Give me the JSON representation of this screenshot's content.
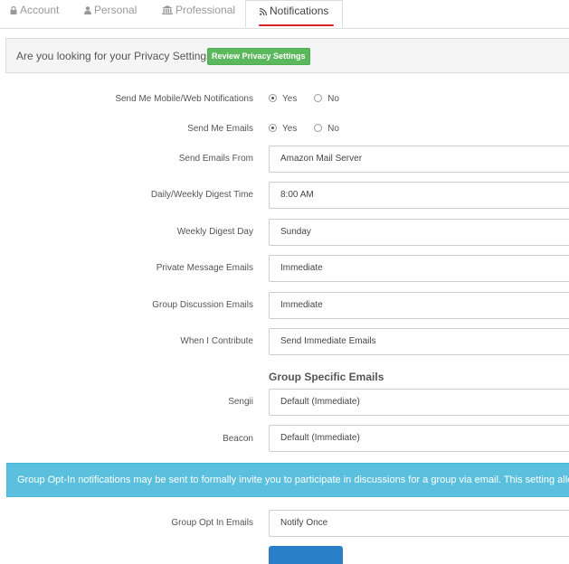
{
  "tabs": [
    {
      "label": "Account",
      "icon": "lock-icon"
    },
    {
      "label": "Personal",
      "icon": "user-icon"
    },
    {
      "label": "Professional",
      "icon": "institution-icon"
    },
    {
      "label": "Notifications",
      "icon": "rss-icon",
      "active": true
    }
  ],
  "privacy": {
    "text": "Are you looking for your Privacy Settings?",
    "button": "Review Privacy Settings"
  },
  "form": {
    "mobile_web": {
      "label": "Send Me Mobile/Web Notifications",
      "yes": "Yes",
      "no": "No",
      "selected": "Yes"
    },
    "emails": {
      "label": "Send Me Emails",
      "yes": "Yes",
      "no": "No",
      "selected": "Yes"
    },
    "emails_from": {
      "label": "Send Emails From",
      "value": "Amazon Mail Server"
    },
    "digest_time": {
      "label": "Daily/Weekly Digest Time",
      "value": "8:00 AM"
    },
    "digest_day": {
      "label": "Weekly Digest Day",
      "value": "Sunday"
    },
    "private_msg": {
      "label": "Private Message Emails",
      "value": "Immediate"
    },
    "group_discussion": {
      "label": "Group Discussion Emails",
      "value": "Immediate"
    },
    "contribute": {
      "label": "When I Contribute",
      "value": "Send Immediate Emails"
    }
  },
  "group_specific": {
    "heading": "Group Specific Emails",
    "sengii": {
      "label": "Sengii",
      "value": "Default (Immediate)"
    },
    "beacon": {
      "label": "Beacon",
      "value": "Default (Immediate)"
    }
  },
  "info": {
    "text": "Group Opt-In notifications may be sent to formally invite you to participate in discussions for a group via email. This setting allows"
  },
  "opt_in": {
    "label": "Group Opt In Emails",
    "value": "Notify Once"
  },
  "colors": {
    "accent": "#d9262c",
    "success": "#5cb85c",
    "info": "#5bc0de",
    "primary": "#2a7fc9"
  }
}
